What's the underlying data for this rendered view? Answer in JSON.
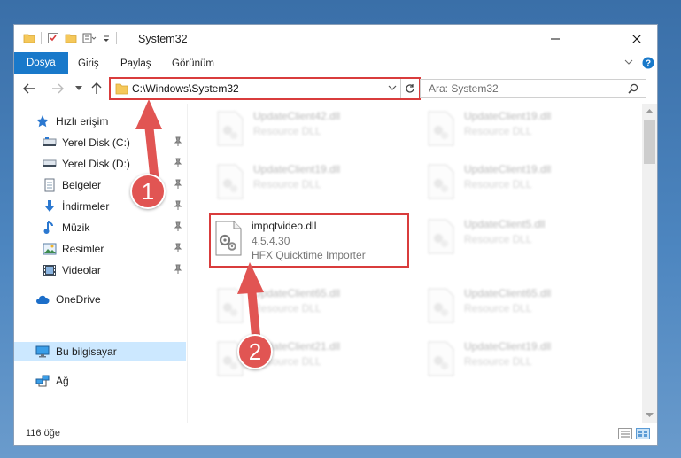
{
  "window": {
    "title": "System32",
    "controls": [
      "minimize",
      "maximize",
      "close"
    ]
  },
  "ribbon": {
    "tabs": [
      "Dosya",
      "Giriş",
      "Paylaş",
      "Görünüm"
    ],
    "active_tab": "Dosya",
    "accent": "#1979ca"
  },
  "address_bar": {
    "path": "C:\\Windows\\System32",
    "highlight_color": "#d93c3c"
  },
  "search": {
    "placeholder": "Ara: System32"
  },
  "sidebar": {
    "quick_access": "Hızlı erişim",
    "pinned": [
      {
        "label": "Yerel Disk (C:)",
        "icon": "drive-icon"
      },
      {
        "label": "Yerel Disk (D:)",
        "icon": "drive-icon"
      },
      {
        "label": "Belgeler",
        "icon": "documents-icon"
      },
      {
        "label": "İndirmeler",
        "icon": "downloads-icon"
      },
      {
        "label": "Müzik",
        "icon": "music-icon"
      },
      {
        "label": "Resimler",
        "icon": "pictures-icon"
      },
      {
        "label": "Videolar",
        "icon": "videos-icon"
      }
    ],
    "onedrive": "OneDrive",
    "this_pc": "Bu bilgisayar",
    "network": "Ağ",
    "selected": "Bu bilgisayar"
  },
  "files": {
    "left_column": [
      {
        "name": "UpdateClient42.dll",
        "desc": "Resource DLL"
      },
      {
        "name": "UpdateClient19.dll",
        "desc": "Resource DLL"
      },
      {
        "name": "impqtvideo.dll",
        "version": "4.5.4.30",
        "desc": "HFX Quicktime Importer"
      },
      {
        "name": "UpdateClient65.dll",
        "desc": "Resource DLL"
      },
      {
        "name": "UpdateClient21.dll",
        "desc": "Resource DLL"
      }
    ],
    "right_column": [
      {
        "name": "UpdateClient19.dll",
        "desc": "Resource DLL"
      },
      {
        "name": "UpdateClient19.dll",
        "desc": "Resource DLL"
      },
      {
        "name": "UpdateClient5.dll",
        "desc": "Resource DLL"
      },
      {
        "name": "UpdateClient65.dll",
        "desc": "Resource DLL"
      },
      {
        "name": "UpdateClient19.dll",
        "desc": "Resource DLL"
      }
    ]
  },
  "status": {
    "item_count": "116 öğe"
  },
  "callouts": {
    "first": "1",
    "second": "2",
    "color": "#e15553"
  }
}
